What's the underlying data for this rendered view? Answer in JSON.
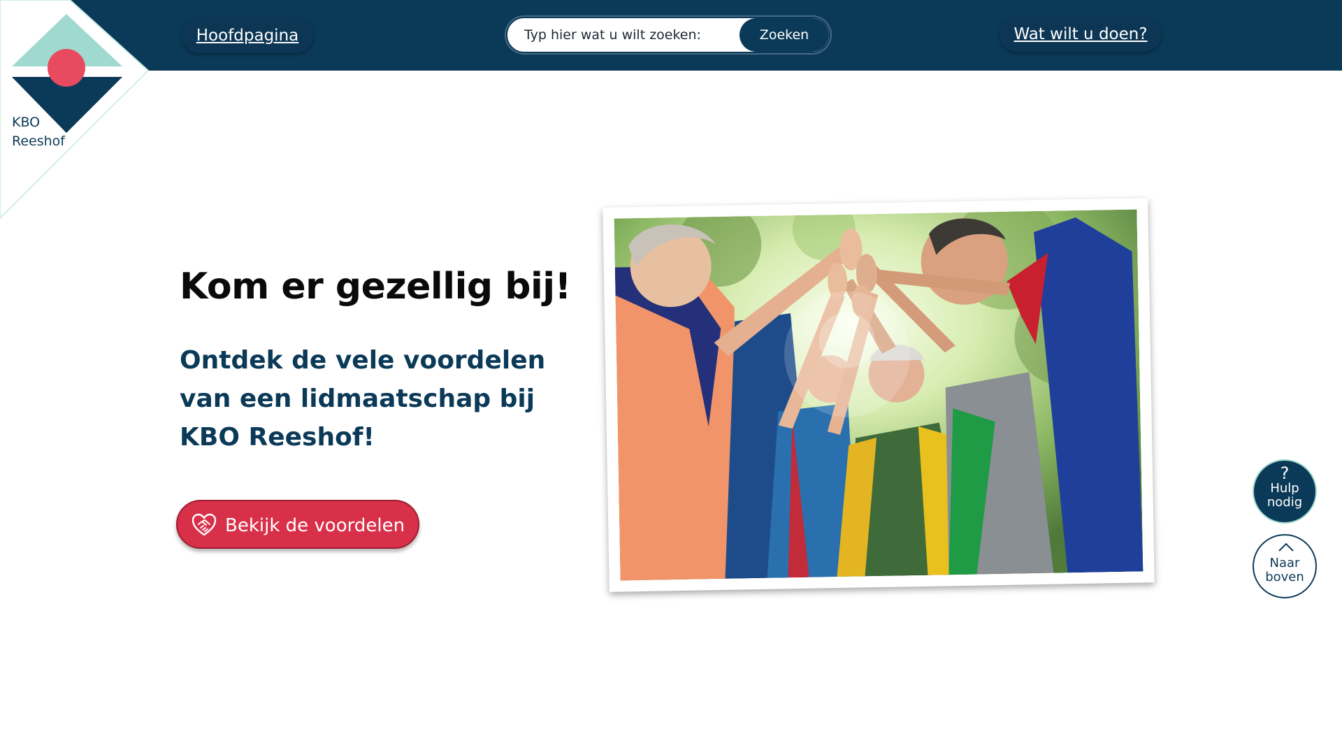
{
  "header": {
    "home_label": "Hoofdpagina",
    "search": {
      "placeholder": "Typ hier wat u wilt zoeken:",
      "value": "",
      "button_label": "Zoeken"
    },
    "todo_label": "Wat wilt u doen?"
  },
  "logo": {
    "line1": "KBO",
    "line2": "Reeshof"
  },
  "hero": {
    "title": "Kom er gezellig bij!",
    "subtitle": "Ontdek de vele voordelen van een lidmaatschap bij KBO Reeshof!",
    "cta_label": "Bekijk de voordelen",
    "cta_icon": "handshake-heart-icon"
  },
  "floating": {
    "help_symbol": "?",
    "help_label": "Hulp\nnodig",
    "top_label": "Naar\nboven"
  },
  "colors": {
    "navy": "#0b3a58",
    "teal": "#9fd9cf",
    "coral": "#e84a5f",
    "cta_red": "#d9304a"
  }
}
